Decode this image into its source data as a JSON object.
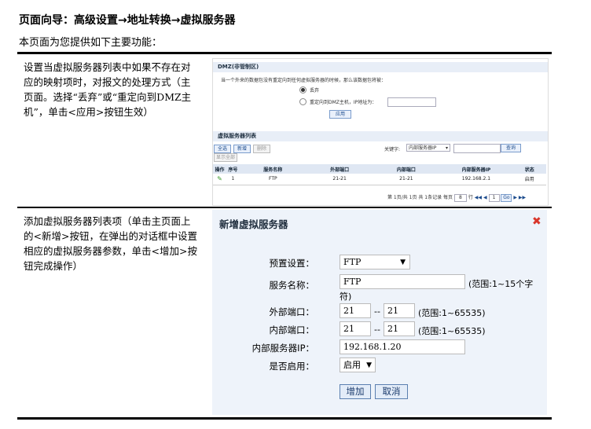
{
  "header": {
    "title": "页面向导：高级设置→地址转换→虚拟服务器",
    "subtitle": "本页面为您提供如下主要功能："
  },
  "row1": {
    "description": "设置当虚拟服务器列表中如果不存在对应的映射项时，对报文的处理方式（主页面。选择“丢弃”或“重定向到DMZ主机”，单击<应用>按钮生效）",
    "dmz": {
      "title": "DMZ(非管制区)",
      "desc": "当一个外来的数据包没有重定向到任何虚拟服务器的时候，那么该数据包将被：",
      "option_drop": "丢弃",
      "option_redirect": "重定向到DMZ主机，IP地址为：",
      "apply": "应用"
    },
    "list": {
      "title": "虚拟服务器列表",
      "btn_select_all": "全选",
      "btn_add": "新增",
      "btn_delete": "删除",
      "btn_show_all": "显示全部",
      "keyword_label": "关键字:",
      "keyword_select": "内部服务器IP",
      "query": "查询",
      "columns": [
        "操作",
        "序号",
        "服务名称",
        "外部端口",
        "内部端口",
        "内部服务器IP",
        "状态"
      ],
      "rows": [
        {
          "index": "1",
          "name": "FTP",
          "ext": "21-21",
          "int": "21-21",
          "ip": "192.168.2.1",
          "status": "启用"
        }
      ],
      "pager_text": "第 1页/共 1页 共 1条记录 每页",
      "pager_size": "8",
      "pager_unit": "行",
      "pager_first": "◀◀",
      "pager_prev": "◀",
      "pager_page": "1",
      "pager_go": "Go",
      "pager_next": "▶",
      "pager_last": "▶▶"
    }
  },
  "row2": {
    "description": "添加虚拟服务器列表项（单击主页面上的<新增>按钮，在弹出的对话框中设置相应的虚拟服务器参数，单击<增加>按钮完成操作）",
    "dialog": {
      "title": "新增虚拟服务器",
      "preset_label": "预置设置：",
      "preset_value": "FTP",
      "name_label": "服务名称：",
      "name_value": "FTP",
      "name_hint": "(范围:1~15个字",
      "name_hint2": "符)",
      "ext_label": "外部端口：",
      "ext_from": "21",
      "ext_to": "21",
      "port_sep": "--",
      "port_hint": "(范围:1~65535)",
      "int_label": "内部端口：",
      "int_from": "21",
      "int_to": "21",
      "ip_label": "内部服务器IP：",
      "ip_value": "192.168.1.20",
      "enable_label": "是否启用：",
      "enable_value": "启用",
      "add_button": "增加",
      "cancel_button": "取消"
    }
  },
  "colors": {
    "close": "#d9362b",
    "edit": "#3a9a2a",
    "accent": "#1a4a8c"
  }
}
